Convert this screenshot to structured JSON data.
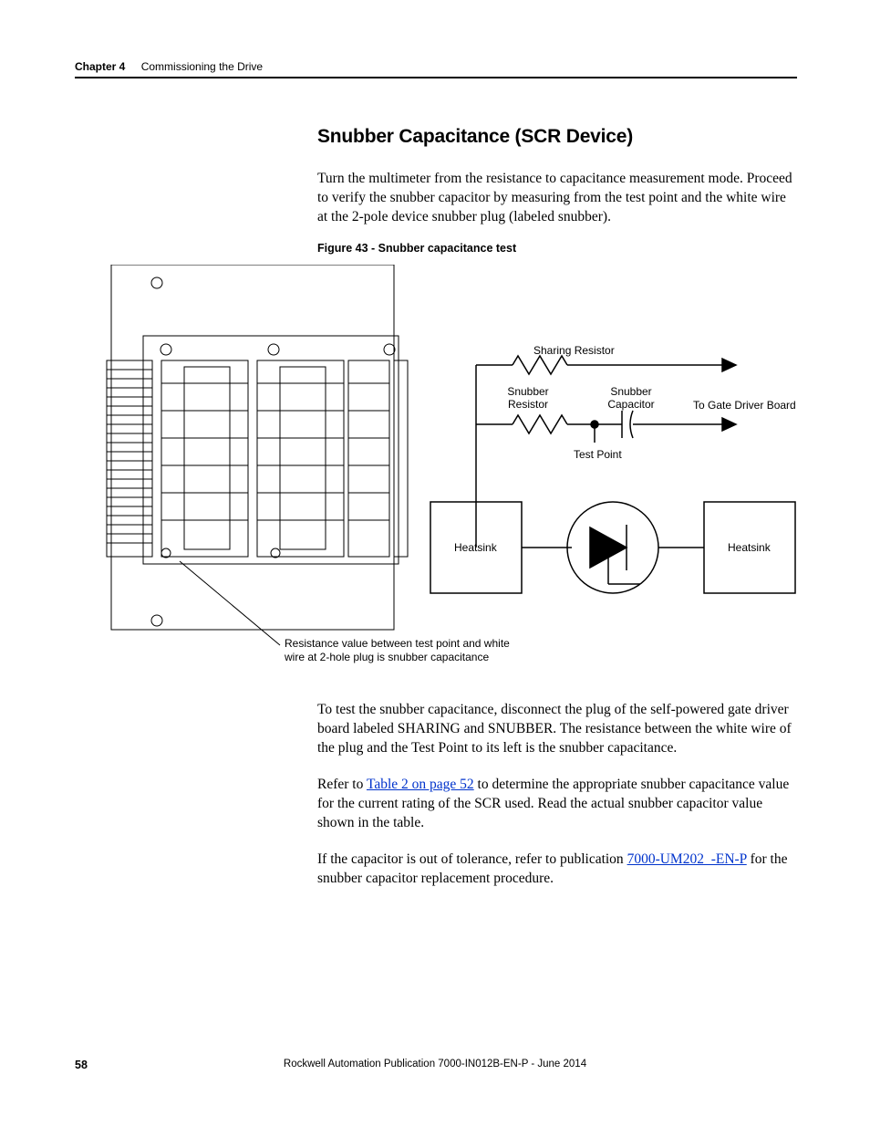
{
  "header": {
    "chapter": "Chapter 4",
    "section": "Commissioning the Drive"
  },
  "heading": "Snubber Capacitance (SCR Device)",
  "paragraphs": {
    "p1": "Turn the multimeter from the resistance to capacitance measurement mode. Proceed to verify the snubber capacitor by measuring from the test point and the white wire at the 2-pole device snubber plug (labeled snubber).",
    "p2": "To test the snubber capacitance, disconnect the plug of the self-powered gate driver board labeled SHARING and SNUBBER. The resistance between the white wire of the plug and the Test Point to its left is the snubber capacitance.",
    "p3a": "Refer to ",
    "p3_link": "Table 2 on page 52",
    "p3b": " to determine the appropriate snubber capacitance value for the current rating of the SCR used. Read the actual snubber capacitor value shown in the table.",
    "p4a": "If the capacitor is out of tolerance, refer to publication ",
    "p4_link": "7000-UM202_-EN-P",
    "p4b": " for the snubber capacitor replacement procedure."
  },
  "figure": {
    "caption": "Figure 43 - Snubber capacitance test",
    "labels": {
      "sharing_resistor": "Sharing Resistor",
      "snubber_resistor": "Snubber\nResistor",
      "snubber_capacitor": "Snubber\nCapacitor",
      "to_gate": "To Gate Driver Board",
      "test_point": "Test Point",
      "heatsink1": "Heatsink",
      "heatsink2": "Heatsink",
      "note": "Resistance value between test point and white wire at 2-hole plug is snubber capacitance"
    }
  },
  "footer": {
    "page": "58",
    "pub": "Rockwell Automation Publication 7000-IN012B-EN-P - June 2014"
  }
}
